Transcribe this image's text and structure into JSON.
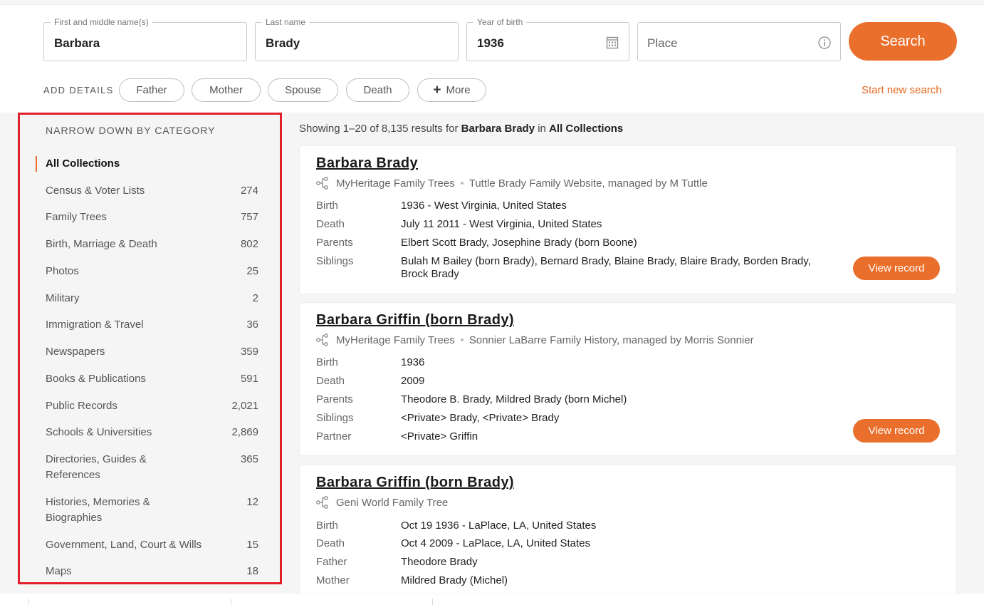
{
  "search": {
    "first_name_label": "First and middle name(s)",
    "first_name_value": "Barbara",
    "last_name_label": "Last name",
    "last_name_value": "Brady",
    "birth_year_label": "Year of birth",
    "birth_year_value": "1936",
    "place_placeholder": "Place",
    "search_button": "Search"
  },
  "add_details": {
    "label": "ADD DETAILS",
    "chips": [
      "Father",
      "Mother",
      "Spouse",
      "Death",
      "More"
    ],
    "start_new_search": "Start new search"
  },
  "sidebar": {
    "title": "NARROW DOWN BY CATEGORY",
    "categories": [
      {
        "label": "All Collections",
        "count": ""
      },
      {
        "label": "Census & Voter Lists",
        "count": "274"
      },
      {
        "label": "Family Trees",
        "count": "757"
      },
      {
        "label": "Birth, Marriage & Death",
        "count": "802"
      },
      {
        "label": "Photos",
        "count": "25"
      },
      {
        "label": "Military",
        "count": "2"
      },
      {
        "label": "Immigration & Travel",
        "count": "36"
      },
      {
        "label": "Newspapers",
        "count": "359"
      },
      {
        "label": "Books & Publications",
        "count": "591"
      },
      {
        "label": "Public Records",
        "count": "2,021"
      },
      {
        "label": "Schools & Universities",
        "count": "2,869"
      },
      {
        "label": "Directories, Guides & References",
        "count": "365"
      },
      {
        "label": "Histories, Memories & Biographies",
        "count": "12"
      },
      {
        "label": "Government, Land, Court & Wills",
        "count": "15"
      },
      {
        "label": "Maps",
        "count": "18"
      }
    ]
  },
  "results_summary": {
    "prefix": "Showing 1–20 of 8,135 results for",
    "query": "Barbara Brady",
    "middle": "in",
    "collection": "All Collections"
  },
  "results": [
    {
      "name": "Barbara Brady",
      "source": "MyHeritage Family Trees",
      "source_detail": "Tuttle Brady Family Website, managed by M Tuttle",
      "fields": [
        {
          "label": "Birth",
          "value": "1936 - West Virginia, United States"
        },
        {
          "label": "Death",
          "value": "July 11 2011 - West Virginia, United States"
        },
        {
          "label": "Parents",
          "value": "Elbert Scott Brady, Josephine Brady (born Boone)"
        },
        {
          "label": "Siblings",
          "value": "Bulah M Bailey (born Brady), Bernard Brady, Blaine Brady, Blaire Brady, Borden Brady, Brock Brady"
        }
      ],
      "button": "View record"
    },
    {
      "name": "Barbara Griffin (born Brady)",
      "source": "MyHeritage Family Trees",
      "source_detail": "Sonnier LaBarre Family History, managed by Morris Sonnier",
      "fields": [
        {
          "label": "Birth",
          "value": "1936"
        },
        {
          "label": "Death",
          "value": "2009"
        },
        {
          "label": "Parents",
          "value": "Theodore B. Brady, Mildred Brady (born Michel)"
        },
        {
          "label": "Siblings",
          "value": "<Private> Brady, <Private> Brady"
        },
        {
          "label": "Partner",
          "value": "<Private> Griffin"
        }
      ],
      "button": "View record"
    },
    {
      "name": "Barbara Griffin (born Brady)",
      "source": "Geni World Family Tree",
      "source_detail": "",
      "fields": [
        {
          "label": "Birth",
          "value": "Oct 19 1936 - LaPlace, LA, United States"
        },
        {
          "label": "Death",
          "value": "Oct 4 2009 - LaPlace, LA, United States"
        },
        {
          "label": "Father",
          "value": "Theodore Brady"
        },
        {
          "label": "Mother",
          "value": "Mildred Brady (Michel)"
        }
      ],
      "button": ""
    }
  ],
  "colors": {
    "accent": "#eb6f2c",
    "highlight_border": "#e0202a",
    "background_grey": "#f5f5f5"
  }
}
